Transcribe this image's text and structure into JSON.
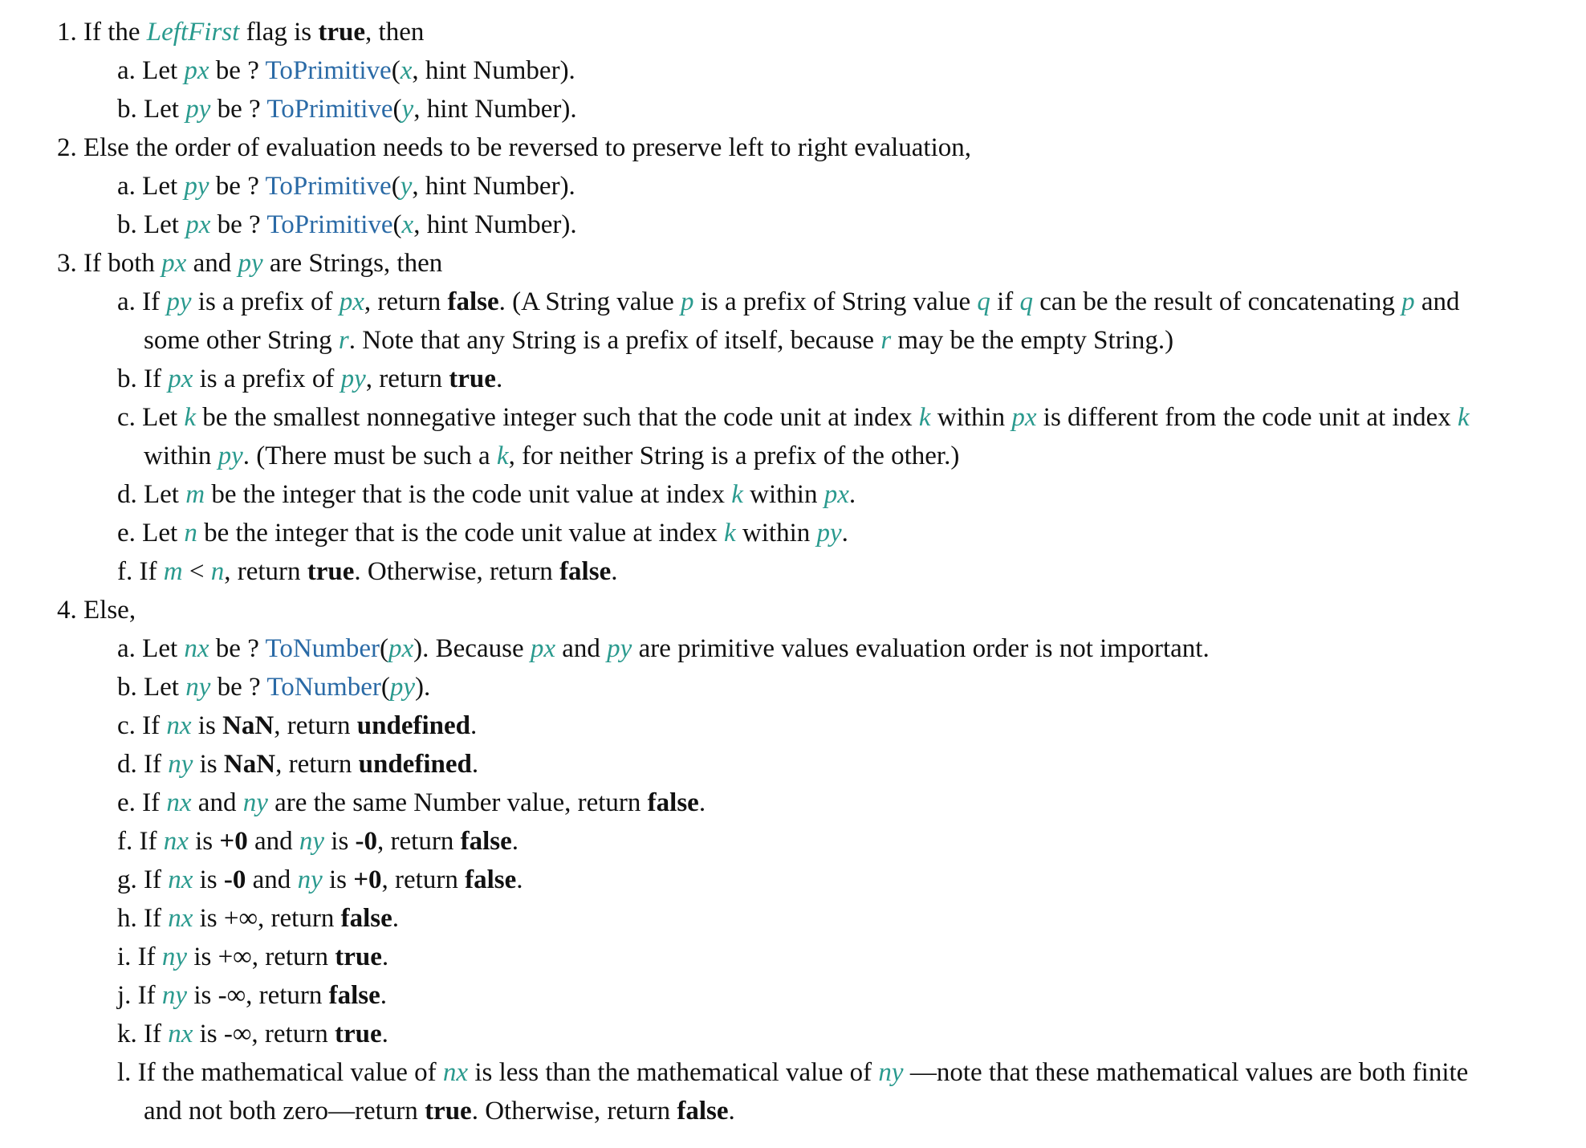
{
  "colors": {
    "variable": "#2a9a8e",
    "link": "#2a6aa6",
    "text": "#111111"
  },
  "lines": [
    {
      "level": 1,
      "num": "1.",
      "segs": [
        [
          "t",
          "If the "
        ],
        [
          "v",
          "LeftFirst"
        ],
        [
          "t",
          " flag is "
        ],
        [
          "b",
          "true"
        ],
        [
          "t",
          ", then"
        ]
      ]
    },
    {
      "level": 2,
      "num": "a.",
      "segs": [
        [
          "t",
          "Let "
        ],
        [
          "v",
          "px"
        ],
        [
          "t",
          " be ? "
        ],
        [
          "l",
          "ToPrimitive"
        ],
        [
          "t",
          "("
        ],
        [
          "v",
          "x"
        ],
        [
          "t",
          ", hint Number)."
        ]
      ]
    },
    {
      "level": 2,
      "num": "b.",
      "segs": [
        [
          "t",
          "Let "
        ],
        [
          "v",
          "py"
        ],
        [
          "t",
          " be ? "
        ],
        [
          "l",
          "ToPrimitive"
        ],
        [
          "t",
          "("
        ],
        [
          "v",
          "y"
        ],
        [
          "t",
          ", hint Number)."
        ]
      ]
    },
    {
      "level": 1,
      "num": "2.",
      "segs": [
        [
          "t",
          "Else the order of evaluation needs to be reversed to preserve left to right evaluation,"
        ]
      ]
    },
    {
      "level": 2,
      "num": "a.",
      "segs": [
        [
          "t",
          "Let "
        ],
        [
          "v",
          "py"
        ],
        [
          "t",
          " be ? "
        ],
        [
          "l",
          "ToPrimitive"
        ],
        [
          "t",
          "("
        ],
        [
          "v",
          "y"
        ],
        [
          "t",
          ", hint Number)."
        ]
      ]
    },
    {
      "level": 2,
      "num": "b.",
      "segs": [
        [
          "t",
          "Let "
        ],
        [
          "v",
          "px"
        ],
        [
          "t",
          " be ? "
        ],
        [
          "l",
          "ToPrimitive"
        ],
        [
          "t",
          "("
        ],
        [
          "v",
          "x"
        ],
        [
          "t",
          ", hint Number)."
        ]
      ]
    },
    {
      "level": 1,
      "num": "3.",
      "segs": [
        [
          "t",
          "If both "
        ],
        [
          "v",
          "px"
        ],
        [
          "t",
          " and "
        ],
        [
          "v",
          "py"
        ],
        [
          "t",
          " are Strings, then"
        ]
      ]
    },
    {
      "level": 2,
      "num": "a.",
      "segs": [
        [
          "t",
          "If "
        ],
        [
          "v",
          "py"
        ],
        [
          "t",
          " is a prefix of "
        ],
        [
          "v",
          "px"
        ],
        [
          "t",
          ", return "
        ],
        [
          "b",
          "false"
        ],
        [
          "t",
          ". (A String value "
        ],
        [
          "v",
          "p"
        ],
        [
          "t",
          " is a prefix of String value "
        ],
        [
          "v",
          "q"
        ],
        [
          "t",
          " if "
        ],
        [
          "v",
          "q"
        ],
        [
          "t",
          " can be the result of concatenating "
        ],
        [
          "v",
          "p"
        ],
        [
          "t",
          " and"
        ]
      ]
    },
    {
      "level": 3,
      "num": "",
      "segs": [
        [
          "t",
          "some other String "
        ],
        [
          "v",
          "r"
        ],
        [
          "t",
          ". Note that any String is a prefix of itself, because "
        ],
        [
          "v",
          "r"
        ],
        [
          "t",
          " may be the empty String.)"
        ]
      ]
    },
    {
      "level": 2,
      "num": "b.",
      "segs": [
        [
          "t",
          "If "
        ],
        [
          "v",
          "px"
        ],
        [
          "t",
          " is a prefix of "
        ],
        [
          "v",
          "py"
        ],
        [
          "t",
          ", return "
        ],
        [
          "b",
          "true"
        ],
        [
          "t",
          "."
        ]
      ]
    },
    {
      "level": 2,
      "num": "c.",
      "segs": [
        [
          "t",
          "Let "
        ],
        [
          "v",
          "k"
        ],
        [
          "t",
          " be the smallest nonnegative integer such that the code unit at index "
        ],
        [
          "v",
          "k"
        ],
        [
          "t",
          " within "
        ],
        [
          "v",
          "px"
        ],
        [
          "t",
          " is different from the code unit at index "
        ],
        [
          "v",
          "k"
        ]
      ]
    },
    {
      "level": 3,
      "num": "",
      "segs": [
        [
          "t",
          "within "
        ],
        [
          "v",
          "py"
        ],
        [
          "t",
          ". (There must be such a "
        ],
        [
          "v",
          "k"
        ],
        [
          "t",
          ", for neither String is a prefix of the other.)"
        ]
      ]
    },
    {
      "level": 2,
      "num": "d.",
      "segs": [
        [
          "t",
          "Let "
        ],
        [
          "v",
          "m"
        ],
        [
          "t",
          " be the integer that is the code unit value at index "
        ],
        [
          "v",
          "k"
        ],
        [
          "t",
          " within "
        ],
        [
          "v",
          "px"
        ],
        [
          "t",
          "."
        ]
      ]
    },
    {
      "level": 2,
      "num": "e.",
      "segs": [
        [
          "t",
          "Let "
        ],
        [
          "v",
          "n"
        ],
        [
          "t",
          " be the integer that is the code unit value at index "
        ],
        [
          "v",
          "k"
        ],
        [
          "t",
          " within "
        ],
        [
          "v",
          "py"
        ],
        [
          "t",
          "."
        ]
      ]
    },
    {
      "level": 2,
      "num": "f.",
      "segs": [
        [
          "t",
          "If "
        ],
        [
          "v",
          "m"
        ],
        [
          "t",
          " < "
        ],
        [
          "v",
          "n"
        ],
        [
          "t",
          ", return "
        ],
        [
          "b",
          "true"
        ],
        [
          "t",
          ". Otherwise, return "
        ],
        [
          "b",
          "false"
        ],
        [
          "t",
          "."
        ]
      ]
    },
    {
      "level": 1,
      "num": "4.",
      "segs": [
        [
          "t",
          "Else,"
        ]
      ]
    },
    {
      "level": 2,
      "num": "a.",
      "segs": [
        [
          "t",
          "Let "
        ],
        [
          "v",
          "nx"
        ],
        [
          "t",
          " be ? "
        ],
        [
          "l",
          "ToNumber"
        ],
        [
          "t",
          "("
        ],
        [
          "v",
          "px"
        ],
        [
          "t",
          "). Because "
        ],
        [
          "v",
          "px"
        ],
        [
          "t",
          " and "
        ],
        [
          "v",
          "py"
        ],
        [
          "t",
          " are primitive values evaluation order is not important."
        ]
      ]
    },
    {
      "level": 2,
      "num": "b.",
      "segs": [
        [
          "t",
          "Let "
        ],
        [
          "v",
          "ny"
        ],
        [
          "t",
          " be ? "
        ],
        [
          "l",
          "ToNumber"
        ],
        [
          "t",
          "("
        ],
        [
          "v",
          "py"
        ],
        [
          "t",
          ")."
        ]
      ]
    },
    {
      "level": 2,
      "num": "c.",
      "segs": [
        [
          "t",
          "If "
        ],
        [
          "v",
          "nx"
        ],
        [
          "t",
          " is "
        ],
        [
          "b",
          "NaN"
        ],
        [
          "t",
          ", return "
        ],
        [
          "b",
          "undefined"
        ],
        [
          "t",
          "."
        ]
      ]
    },
    {
      "level": 2,
      "num": "d.",
      "segs": [
        [
          "t",
          "If "
        ],
        [
          "v",
          "ny"
        ],
        [
          "t",
          " is "
        ],
        [
          "b",
          "NaN"
        ],
        [
          "t",
          ", return "
        ],
        [
          "b",
          "undefined"
        ],
        [
          "t",
          "."
        ]
      ]
    },
    {
      "level": 2,
      "num": "e.",
      "segs": [
        [
          "t",
          "If "
        ],
        [
          "v",
          "nx"
        ],
        [
          "t",
          " and "
        ],
        [
          "v",
          "ny"
        ],
        [
          "t",
          " are the same Number value, return "
        ],
        [
          "b",
          "false"
        ],
        [
          "t",
          "."
        ]
      ]
    },
    {
      "level": 2,
      "num": "f.",
      "segs": [
        [
          "t",
          "If "
        ],
        [
          "v",
          "nx"
        ],
        [
          "t",
          " is "
        ],
        [
          "b",
          "+0"
        ],
        [
          "t",
          " and "
        ],
        [
          "v",
          "ny"
        ],
        [
          "t",
          " is "
        ],
        [
          "b",
          "-0"
        ],
        [
          "t",
          ", return "
        ],
        [
          "b",
          "false"
        ],
        [
          "t",
          "."
        ]
      ]
    },
    {
      "level": 2,
      "num": "g.",
      "segs": [
        [
          "t",
          "If "
        ],
        [
          "v",
          "nx"
        ],
        [
          "t",
          " is "
        ],
        [
          "b",
          "-0"
        ],
        [
          "t",
          " and "
        ],
        [
          "v",
          "ny"
        ],
        [
          "t",
          " is "
        ],
        [
          "b",
          "+0"
        ],
        [
          "t",
          ", return "
        ],
        [
          "b",
          "false"
        ],
        [
          "t",
          "."
        ]
      ]
    },
    {
      "level": 2,
      "num": "h.",
      "segs": [
        [
          "t",
          "If "
        ],
        [
          "v",
          "nx"
        ],
        [
          "t",
          " is +∞, return "
        ],
        [
          "b",
          "false"
        ],
        [
          "t",
          "."
        ]
      ]
    },
    {
      "level": 2,
      "num": "i.",
      "segs": [
        [
          "t",
          "If "
        ],
        [
          "v",
          "ny"
        ],
        [
          "t",
          " is +∞, return "
        ],
        [
          "b",
          "true"
        ],
        [
          "t",
          "."
        ]
      ]
    },
    {
      "level": 2,
      "num": "j.",
      "segs": [
        [
          "t",
          "If "
        ],
        [
          "v",
          "ny"
        ],
        [
          "t",
          " is -∞, return "
        ],
        [
          "b",
          "false"
        ],
        [
          "t",
          "."
        ]
      ]
    },
    {
      "level": 2,
      "num": "k.",
      "segs": [
        [
          "t",
          "If "
        ],
        [
          "v",
          "nx"
        ],
        [
          "t",
          " is -∞, return "
        ],
        [
          "b",
          "true"
        ],
        [
          "t",
          "."
        ]
      ]
    },
    {
      "level": 2,
      "num": "l.",
      "segs": [
        [
          "t",
          "If the mathematical value of "
        ],
        [
          "v",
          "nx"
        ],
        [
          "t",
          " is less than the mathematical value of "
        ],
        [
          "v",
          "ny"
        ],
        [
          "t",
          " —note that these mathematical values are both finite"
        ]
      ]
    },
    {
      "level": 3,
      "num": "",
      "segs": [
        [
          "t",
          "and not both zero—return "
        ],
        [
          "b",
          "true"
        ],
        [
          "t",
          ". Otherwise, return "
        ],
        [
          "b",
          "false"
        ],
        [
          "t",
          "."
        ]
      ]
    }
  ]
}
